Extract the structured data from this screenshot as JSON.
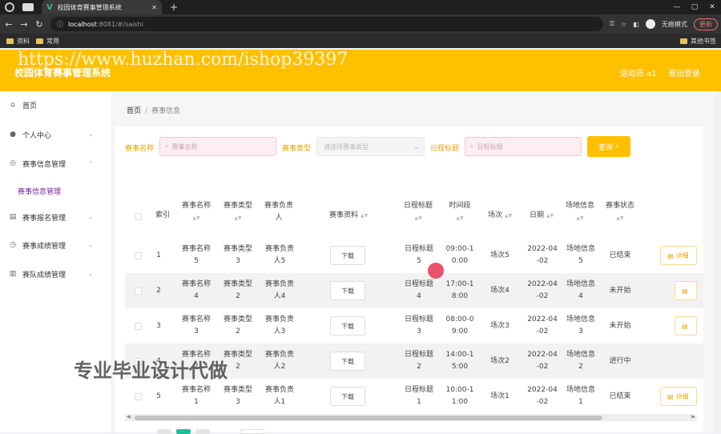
{
  "browser": {
    "tab_title": "校园体育赛事管理系统",
    "url_host": "localhost",
    "url_path": ":8081/#/saishi",
    "profile": "无痕模式",
    "update": "更新",
    "bookmarks": [
      "资料",
      "常用"
    ],
    "bookmarks_right": "其他书签"
  },
  "header": {
    "title": "校园体育赛事管理系统",
    "user": "运动员 a1",
    "logout": "退出登录"
  },
  "watermark": "https://www.huzhan.com/ishop39397",
  "watermark2": "专业毕业设计代做",
  "sidebar": {
    "items": [
      {
        "label": "首页",
        "icon": "home-icon"
      },
      {
        "label": "个人中心",
        "icon": "user-icon",
        "arrow": "⌄"
      },
      {
        "label": "赛事信息管理",
        "icon": "compass-icon",
        "arrow": "⌃"
      },
      {
        "label": "赛事报名管理",
        "icon": "list-icon",
        "arrow": "⌄"
      },
      {
        "label": "赛事成绩管理",
        "icon": "clock-icon",
        "arrow": "⌄"
      },
      {
        "label": "赛队成绩管理",
        "icon": "doc-icon",
        "arrow": "⌄"
      }
    ],
    "sub": "赛事信息管理"
  },
  "breadcrumb": {
    "home": "首页",
    "sep": "/",
    "current": "赛事信息"
  },
  "filters": {
    "name_label": "赛事名称",
    "name_placeholder": "赛事名称",
    "type_label": "赛事类型",
    "type_placeholder": "请选择赛事类型",
    "sched_label": "日程标题",
    "sched_placeholder": "日程标题",
    "query": "查询"
  },
  "columns": [
    "索引",
    "赛事名称",
    "赛事类型",
    "赛事负责人",
    "赛事资料",
    "日程标题",
    "时间段",
    "场次",
    "日期",
    "场地信息",
    "赛事状态"
  ],
  "rows": [
    {
      "idx": "1",
      "name": [
        "赛事名称",
        "5"
      ],
      "type": [
        "赛事类型",
        "3"
      ],
      "owner": [
        "赛事负责",
        "人5"
      ],
      "file": "下载",
      "sched": [
        "日程标题",
        "5"
      ],
      "time": [
        "09:00-1",
        "0:00"
      ],
      "round": "场次5",
      "date": [
        "2022-04",
        "-02"
      ],
      "venue": [
        "场地信息",
        "5"
      ],
      "status": "已结束",
      "detail": "详细"
    },
    {
      "idx": "2",
      "name": [
        "赛事名称",
        "4"
      ],
      "type": [
        "赛事类型",
        "2"
      ],
      "owner": [
        "赛事负责",
        "人4"
      ],
      "file": "下载",
      "sched": [
        "日程标题",
        "4"
      ],
      "time": [
        "17:00-1",
        "8:00"
      ],
      "round": "场次4",
      "date": [
        "2022-04",
        "-02"
      ],
      "venue": [
        "场地信息",
        "4"
      ],
      "status": "未开始",
      "detail": ""
    },
    {
      "idx": "3",
      "name": [
        "赛事名称",
        "3"
      ],
      "type": [
        "赛事类型",
        "2"
      ],
      "owner": [
        "赛事负责",
        "人3"
      ],
      "file": "下载",
      "sched": [
        "日程标题",
        "3"
      ],
      "time": [
        "08:00-0",
        "9:00"
      ],
      "round": "场次3",
      "date": [
        "2022-04",
        "-02"
      ],
      "venue": [
        "场地信息",
        "3"
      ],
      "status": "未开始",
      "detail": ""
    },
    {
      "idx": "4",
      "name": [
        "赛事名称",
        "2"
      ],
      "type": [
        "赛事类型",
        "2"
      ],
      "owner": [
        "赛事负责",
        "人2"
      ],
      "file": "下载",
      "sched": [
        "日程标题",
        "2"
      ],
      "time": [
        "14:00-1",
        "5:00"
      ],
      "round": "场次2",
      "date": [
        "2022-04",
        "-02"
      ],
      "venue": [
        "场地信息",
        "2"
      ],
      "status": "进行中",
      "detail": ""
    },
    {
      "idx": "5",
      "name": [
        "赛事名称",
        "1"
      ],
      "type": [
        "赛事类型",
        "3"
      ],
      "owner": [
        "赛事负责",
        "人1"
      ],
      "file": "下载",
      "sched": [
        "日程标题",
        "1"
      ],
      "time": [
        "10:00-1",
        "1:00"
      ],
      "round": "场次1",
      "date": [
        "2022-04",
        "-02"
      ],
      "venue": [
        "场地信息",
        "1"
      ],
      "status": "已结束",
      "detail": "详细"
    }
  ],
  "colors": {
    "header": "#ffc000",
    "accent": "#e3a700",
    "sub_active": "#7a1fa2"
  }
}
